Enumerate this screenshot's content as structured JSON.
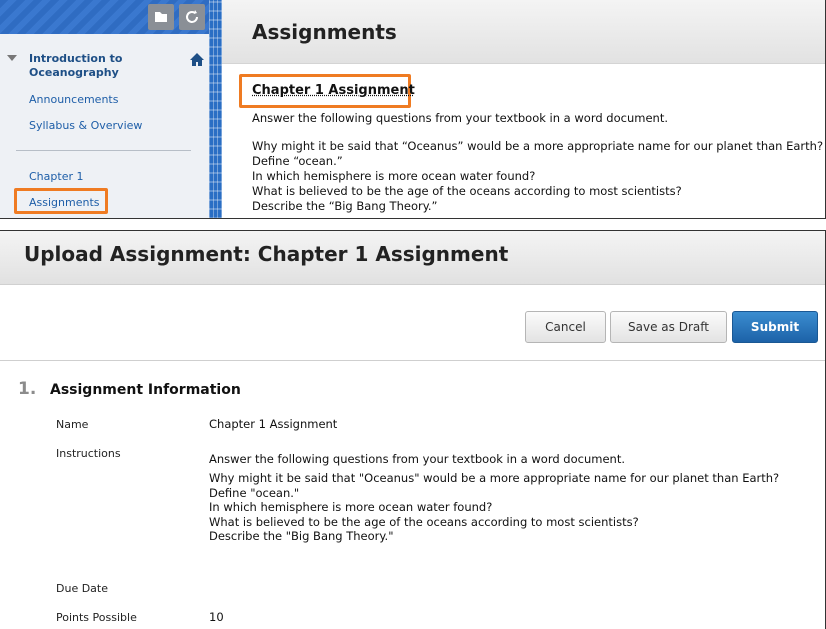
{
  "course_menu": {
    "course_title": "Introduction to Oceanography",
    "links": [
      "Announcements",
      "Syllabus & Overview",
      "Chapter 1",
      "Assignments"
    ]
  },
  "content_area": {
    "page_title": "Assignments",
    "item": {
      "title": "Chapter 1 Assignment",
      "description": "Answer the following questions from your textbook in a word document.",
      "questions": [
        "Why might it be said that “Oceanus” would be a more appropriate name for our planet than Earth?",
        "Define “ocean.”",
        "In which hemisphere is more ocean water found?",
        "What is believed to be the age of the oceans according to most scientists?",
        "Describe the “Big Bang Theory.”"
      ]
    }
  },
  "upload_page": {
    "title": "Upload Assignment: Chapter 1 Assignment",
    "buttons": {
      "cancel": "Cancel",
      "save_draft": "Save as Draft",
      "submit": "Submit"
    },
    "section": {
      "number": "1.",
      "title": "Assignment Information",
      "fields": {
        "name_label": "Name",
        "name_value": "Chapter 1 Assignment",
        "instructions_label": "Instructions",
        "instructions_intro": "Answer the following questions from your textbook in a word document.",
        "instructions_questions": [
          "Why might it be said that \"Oceanus\" would be a more appropriate name for our planet than Earth?",
          "Define \"ocean.\"",
          "In which hemisphere is more ocean water found?",
          "What is believed to be the age of the oceans according to most scientists?",
          "Describe the \"Big Bang Theory.\""
        ],
        "due_date_label": "Due Date",
        "points_label": "Points Possible",
        "points_value": "10"
      }
    }
  },
  "colors": {
    "highlight": "#ef7b22",
    "link": "#1e5ea8",
    "submit": "#2a74bc"
  },
  "icons": [
    "folder-icon",
    "refresh-icon",
    "home-icon",
    "collapse-arrow-icon"
  ]
}
